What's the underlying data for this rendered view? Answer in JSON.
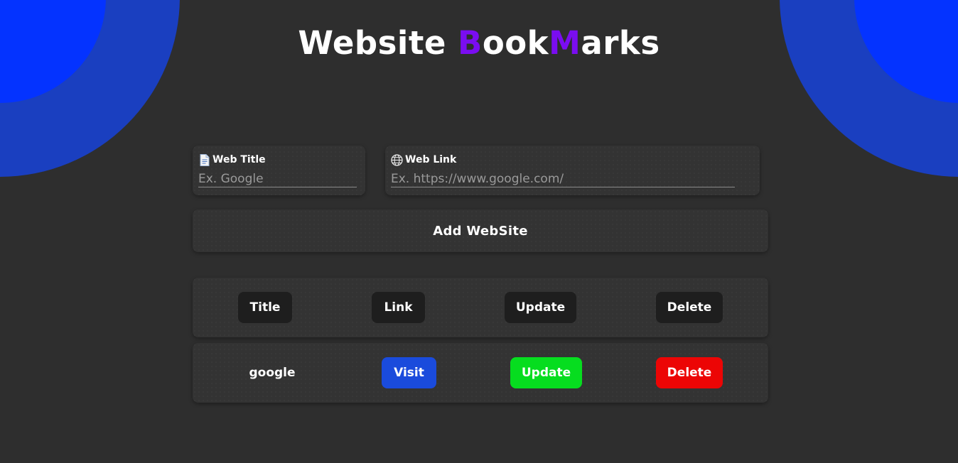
{
  "header": {
    "title_part1": "Website ",
    "title_b": "B",
    "title_ook": "ook",
    "title_m": "M",
    "title_arks": "arks",
    "accent_color": "#7a0df0"
  },
  "form": {
    "title_field": {
      "label": "Web Title",
      "icon": "document-icon",
      "placeholder": "Ex. Google",
      "value": ""
    },
    "link_field": {
      "label": "Web Link",
      "icon": "globe-icon",
      "placeholder": "Ex. https://www.google.com/",
      "value": ""
    },
    "add_button_label": "Add WebSite"
  },
  "table": {
    "headers": [
      "Title",
      "Link",
      "Update",
      "Delete"
    ],
    "rows": [
      {
        "title": "google",
        "visit_label": "Visit",
        "update_label": "Update",
        "delete_label": "Delete"
      }
    ]
  },
  "colors": {
    "background": "#2e2e2e",
    "blob_outer": "#1a3fc0",
    "blob_inner": "#0433ff",
    "visit": "#1a4bdc",
    "update": "#06dd1f",
    "delete": "#ec0505"
  }
}
